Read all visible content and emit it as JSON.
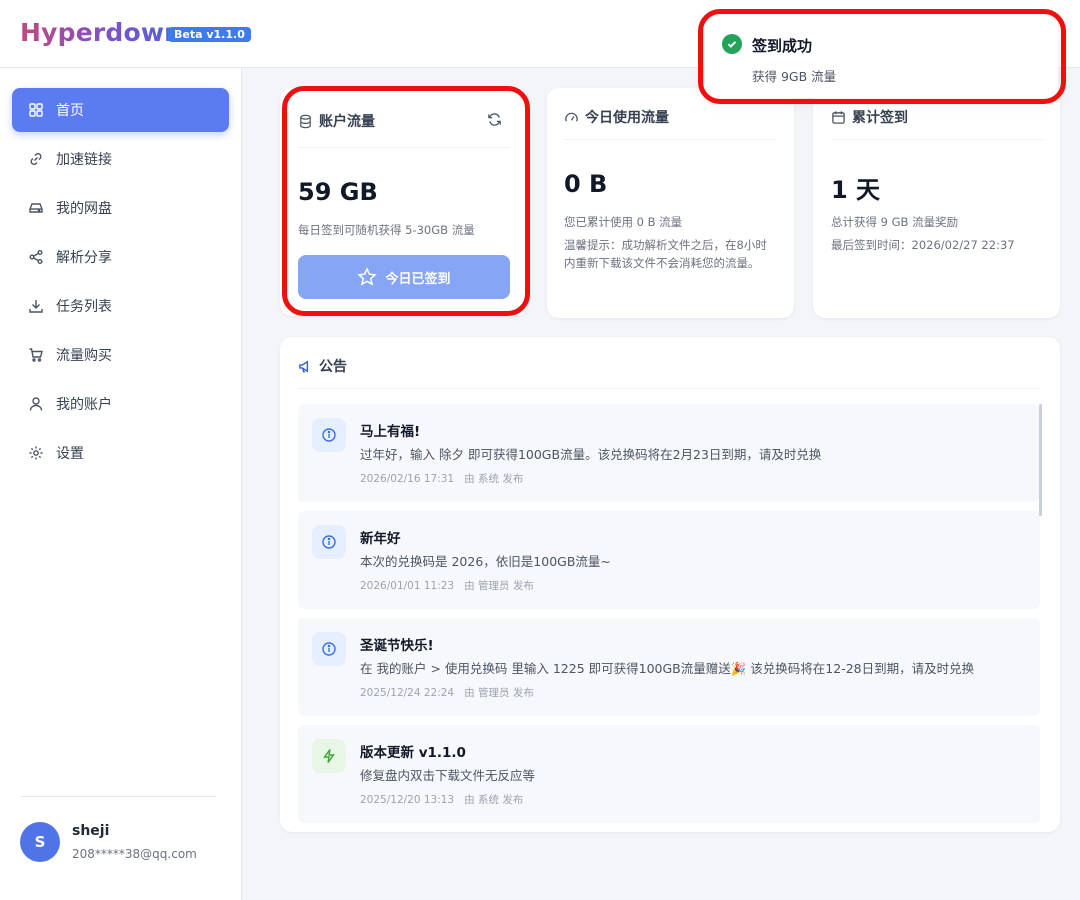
{
  "app": {
    "logo": "Hyperdown",
    "beta_badge": "Beta v1.1.0"
  },
  "sidebar": {
    "items": [
      {
        "label": "首页",
        "icon": "grid-icon",
        "active": true
      },
      {
        "label": "加速链接",
        "icon": "link-icon"
      },
      {
        "label": "我的网盘",
        "icon": "drive-icon"
      },
      {
        "label": "解析分享",
        "icon": "share-icon"
      },
      {
        "label": "任务列表",
        "icon": "download-icon"
      },
      {
        "label": "流量购买",
        "icon": "cart-icon"
      },
      {
        "label": "我的账户",
        "icon": "user-icon"
      },
      {
        "label": "设置",
        "icon": "gear-icon"
      }
    ],
    "user": {
      "avatar_letter": "S",
      "name": "sheji",
      "email": "208*****38@qq.com"
    }
  },
  "cards": {
    "account": {
      "title": "账户流量",
      "value": "59 GB",
      "desc": "每日签到可随机获得 5-30GB 流量",
      "button_label": "今日已签到"
    },
    "today": {
      "title": "今日使用流量",
      "value": "0 B",
      "desc": "您已累计使用 0 B 流量",
      "tip_line1": "温馨提示：成功解析文件之后，在8小时",
      "tip_line2": "内重新下载该文件不会消耗您的流量。"
    },
    "checkin": {
      "title": "累计签到",
      "value": "1 天",
      "desc": "总计获得 9 GB 流量奖励",
      "last": "最后签到时间：2026/02/27 22:37"
    }
  },
  "announcements": {
    "title": "公告",
    "items": [
      {
        "icon": "info-icon",
        "title": "马上有福!",
        "body": "过年好，输入 除夕 即可获得100GB流量。该兑换码将在2月23日到期，请及时兑换",
        "date": "2026/02/16 17:31",
        "by": "由 系统 发布"
      },
      {
        "icon": "info-icon",
        "title": "新年好",
        "body": "本次的兑换码是 2026，依旧是100GB流量~",
        "date": "2026/01/01 11:23",
        "by": "由 管理员 发布"
      },
      {
        "icon": "info-icon",
        "title": "圣诞节快乐!",
        "body": "在 我的账户 > 使用兑换码 里输入 1225 即可获得100GB流量赠送🎉 该兑换码将在12-28日到期，请及时兑换",
        "date": "2025/12/24 22:24",
        "by": "由 管理员 发布"
      },
      {
        "icon": "bolt-icon",
        "title": "版本更新 v1.1.0",
        "body": "修复盘内双击下载文件无反应等",
        "date": "2025/12/20 13:13",
        "by": "由 系统 发布"
      }
    ]
  },
  "toast": {
    "title": "签到成功",
    "body": "获得 9GB 流量"
  },
  "colors": {
    "accent": "#5b7cf0",
    "success": "#22a35a",
    "highlight": "#f10e0e"
  }
}
